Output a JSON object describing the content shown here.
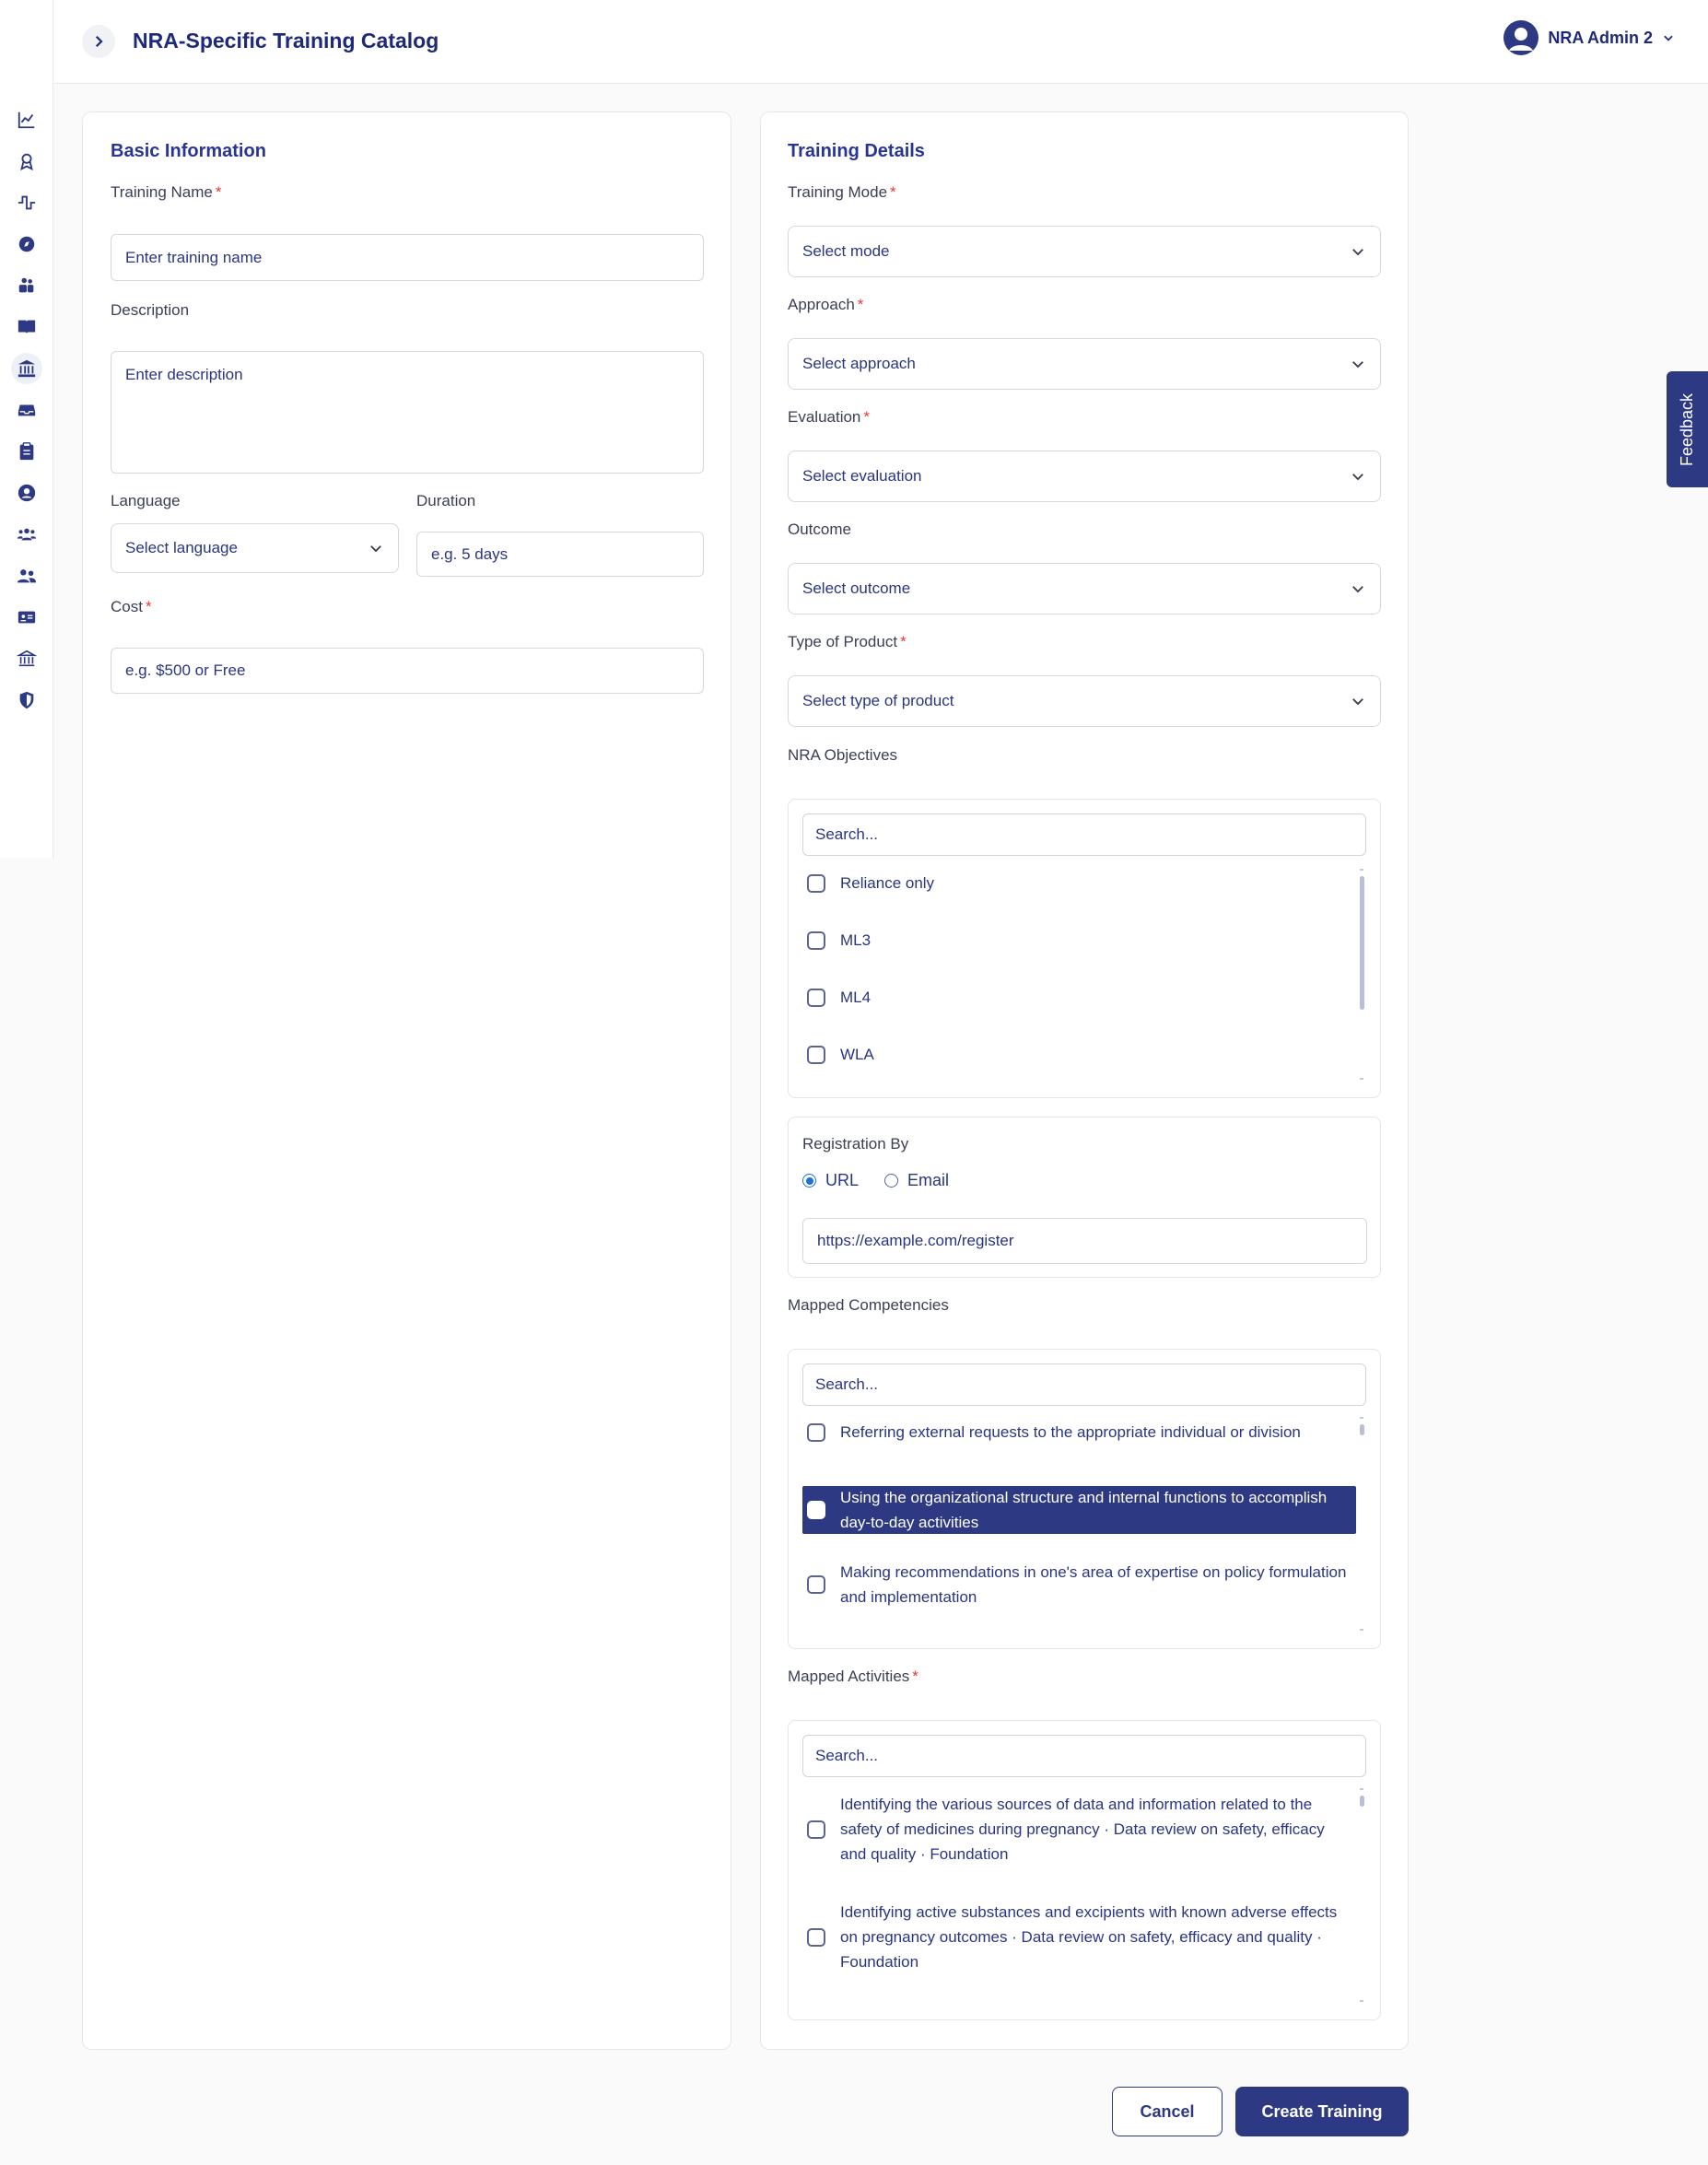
{
  "header": {
    "title": "NRA-Specific Training Catalog",
    "user_name": "NRA Admin 2"
  },
  "sidebar": {
    "icons": [
      "chart-line-icon",
      "award-icon",
      "pulse-icon",
      "compass-icon",
      "people-icon",
      "book-open-icon",
      "institution-icon",
      "inbox-icon",
      "clipboard-icon",
      "user-circle-icon",
      "users-group-icon",
      "user-friends-icon",
      "id-card-icon",
      "landmark-icon",
      "shield-icon"
    ],
    "active_index": 6
  },
  "basic": {
    "title": "Basic Information",
    "training_name_label": "Training Name",
    "training_name_placeholder": "Enter training name",
    "description_label": "Description",
    "description_placeholder": "Enter description",
    "language_label": "Language",
    "language_value": "Select language",
    "duration_label": "Duration",
    "duration_placeholder": "e.g. 5 days",
    "cost_label": "Cost",
    "cost_placeholder": "e.g. $500 or Free"
  },
  "details": {
    "title": "Training Details",
    "mode_label": "Training Mode",
    "mode_value": "Select mode",
    "approach_label": "Approach",
    "approach_value": "Select approach",
    "evaluation_label": "Evaluation",
    "evaluation_value": "Select evaluation",
    "outcome_label": "Outcome",
    "outcome_value": "Select outcome",
    "product_label": "Type of Product",
    "product_value": "Select type of product"
  },
  "objectives": {
    "label": "NRA Objectives",
    "search_placeholder": "Search...",
    "items": [
      "Reliance only",
      "ML3",
      "ML4",
      "WLA"
    ]
  },
  "registration": {
    "label": "Registration By",
    "option_url": "URL",
    "option_email": "Email",
    "selected": "URL",
    "url_placeholder": "https://example.com/register"
  },
  "competencies": {
    "label": "Mapped Competencies",
    "search_placeholder": "Search...",
    "items": [
      "Referring external requests to the appropriate individual or division",
      "Using the organizational structure and internal functions to accomplish day-to-day activities",
      "Making recommendations in one's area of expertise on policy formulation and implementation"
    ],
    "highlighted_index": 1
  },
  "activities": {
    "label": "Mapped Activities",
    "search_placeholder": "Search...",
    "items": [
      "Identifying the various sources of data and information related to the safety of medicines during pregnancy · Data review on safety, efficacy and quality · Foundation",
      "Identifying active substances and excipients with known adverse effects on pregnancy outcomes · Data review on safety, efficacy and quality · Foundation"
    ]
  },
  "actions": {
    "cancel": "Cancel",
    "create": "Create Training"
  },
  "feedback": "Feedback",
  "colors": {
    "primary": "#2d3982",
    "title": "#1e2a78",
    "required": "#e53935",
    "radio_selected": "#1e6fd9"
  }
}
